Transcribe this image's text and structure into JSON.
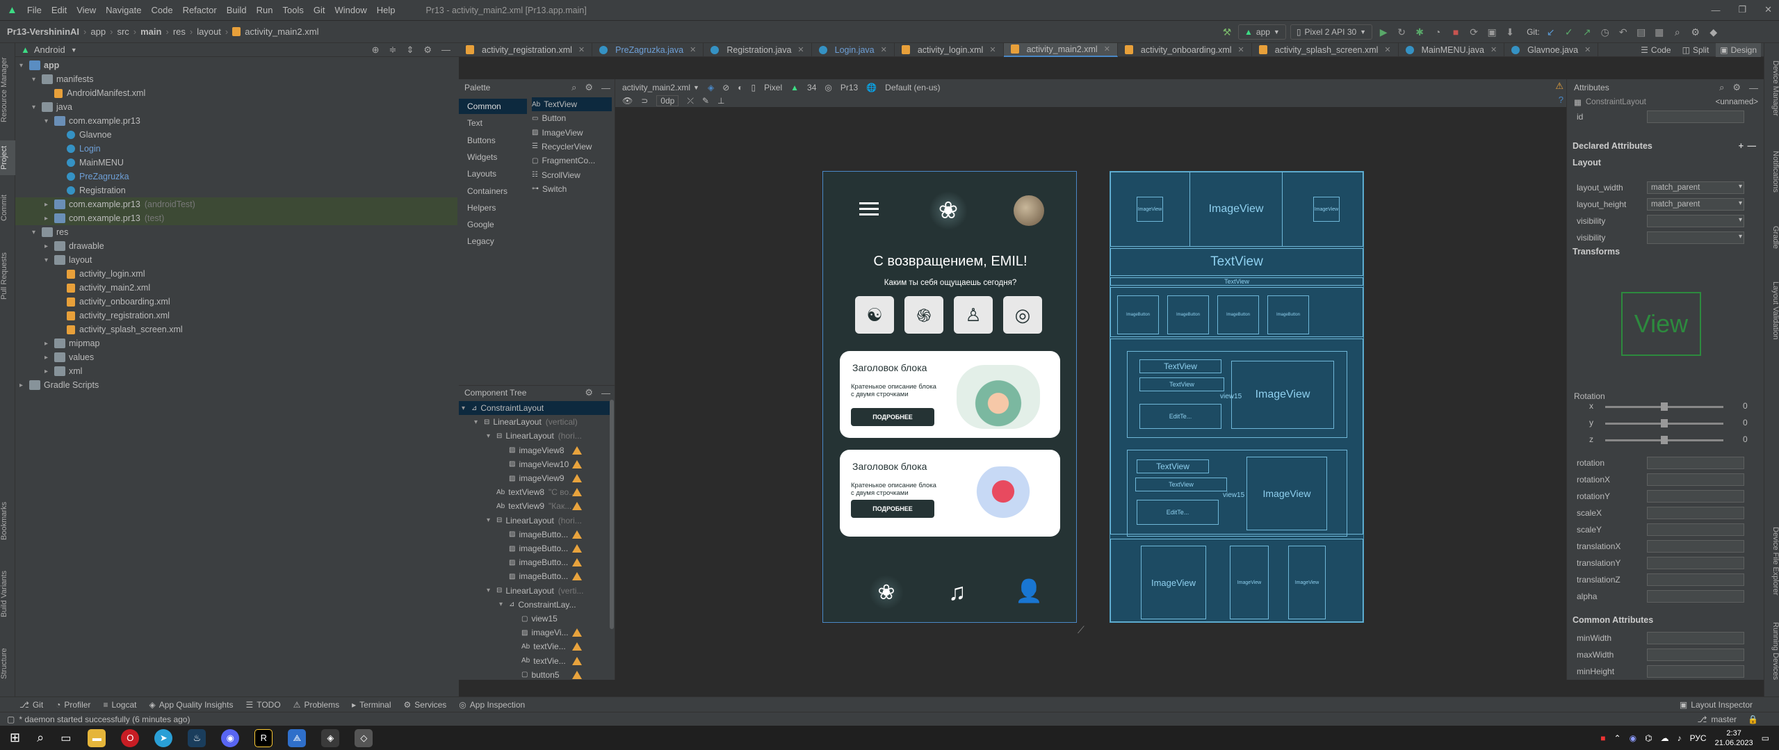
{
  "window": {
    "title": "Pr13 - activity_main2.xml [Pr13.app.main]"
  },
  "menu": [
    "File",
    "Edit",
    "View",
    "Navigate",
    "Code",
    "Refactor",
    "Build",
    "Run",
    "Tools",
    "Git",
    "Window",
    "Help"
  ],
  "breadcrumb": [
    "Pr13-VershininAI",
    "app",
    "src",
    "main",
    "res",
    "layout",
    "activity_main2.xml"
  ],
  "toolbar": {
    "run_config": "app",
    "device": "Pixel 2 API 30",
    "git_label": "Git:"
  },
  "project": {
    "view_mode": "Android"
  },
  "tree": [
    {
      "label": "app",
      "depth": 0,
      "type": "folder",
      "open": true,
      "bold": true
    },
    {
      "label": "manifests",
      "depth": 1,
      "type": "folder",
      "open": true
    },
    {
      "label": "AndroidManifest.xml",
      "depth": 2,
      "type": "xml"
    },
    {
      "label": "java",
      "depth": 1,
      "type": "folder",
      "open": true
    },
    {
      "label": "com.example.pr13",
      "depth": 2,
      "type": "pkg",
      "open": true
    },
    {
      "label": "Glavnoe",
      "depth": 3,
      "type": "java"
    },
    {
      "label": "Login",
      "depth": 3,
      "type": "java",
      "color": "#6e9fd6"
    },
    {
      "label": "MainMENU",
      "depth": 3,
      "type": "java"
    },
    {
      "label": "PreZagruzka",
      "depth": 3,
      "type": "java",
      "color": "#6e9fd6"
    },
    {
      "label": "Registration",
      "depth": 3,
      "type": "java"
    },
    {
      "label": "com.example.pr13",
      "depth": 2,
      "type": "pkg",
      "note": "(androidTest)",
      "highlight": true
    },
    {
      "label": "com.example.pr13",
      "depth": 2,
      "type": "pkg",
      "note": "(test)",
      "highlight": true
    },
    {
      "label": "res",
      "depth": 1,
      "type": "folder",
      "open": true
    },
    {
      "label": "drawable",
      "depth": 2,
      "type": "folder"
    },
    {
      "label": "layout",
      "depth": 2,
      "type": "folder",
      "open": true
    },
    {
      "label": "activity_login.xml",
      "depth": 3,
      "type": "xml"
    },
    {
      "label": "activity_main2.xml",
      "depth": 3,
      "type": "xml"
    },
    {
      "label": "activity_onboarding.xml",
      "depth": 3,
      "type": "xml"
    },
    {
      "label": "activity_registration.xml",
      "depth": 3,
      "type": "xml"
    },
    {
      "label": "activity_splash_screen.xml",
      "depth": 3,
      "type": "xml"
    },
    {
      "label": "mipmap",
      "depth": 2,
      "type": "folder"
    },
    {
      "label": "values",
      "depth": 2,
      "type": "folder"
    },
    {
      "label": "xml",
      "depth": 2,
      "type": "folder"
    },
    {
      "label": "Gradle Scripts",
      "depth": 0,
      "type": "gradle"
    }
  ],
  "editor_tabs": [
    {
      "label": "activity_registration.xml",
      "type": "xml"
    },
    {
      "label": "PreZagruzka.java",
      "type": "java",
      "color": "#6e9fd6"
    },
    {
      "label": "Registration.java",
      "type": "java"
    },
    {
      "label": "Login.java",
      "type": "java",
      "color": "#6e9fd6"
    },
    {
      "label": "activity_login.xml",
      "type": "xml"
    },
    {
      "label": "activity_main2.xml",
      "type": "xml",
      "active": true
    },
    {
      "label": "activity_onboarding.xml",
      "type": "xml"
    },
    {
      "label": "activity_splash_screen.xml",
      "type": "xml"
    },
    {
      "label": "MainMENU.java",
      "type": "java"
    },
    {
      "label": "Glavnoe.java",
      "type": "java"
    }
  ],
  "view_modes": [
    "Code",
    "Split",
    "Design"
  ],
  "palette": {
    "title": "Palette",
    "categories": [
      "Common",
      "Text",
      "Buttons",
      "Widgets",
      "Layouts",
      "Containers",
      "Helpers",
      "Google",
      "Legacy"
    ],
    "items": [
      "TextView",
      "Button",
      "ImageView",
      "RecyclerView",
      "FragmentCo...",
      "ScrollView",
      "Switch"
    ]
  },
  "design_toolbar": {
    "file": "activity_main2.xml",
    "device": "Pixel",
    "api": "34",
    "theme": "Pr13",
    "locale": "Default (en-us)",
    "dp": "0dp"
  },
  "component_tree": {
    "title": "Component Tree",
    "items": [
      {
        "label": "ConstraintLayout",
        "depth": 0,
        "sel": true
      },
      {
        "label": "LinearLayout",
        "note": "(vertical)",
        "depth": 1
      },
      {
        "label": "LinearLayout",
        "note": "(hori...",
        "depth": 2
      },
      {
        "label": "imageView8",
        "depth": 3,
        "warn": true
      },
      {
        "label": "imageView10",
        "depth": 3,
        "warn": true
      },
      {
        "label": "imageView9",
        "depth": 3,
        "warn": true
      },
      {
        "label": "textView8",
        "note": "\"С во...",
        "depth": 2,
        "warn": true
      },
      {
        "label": "textView9",
        "note": "\"Как...",
        "depth": 2,
        "warn": true
      },
      {
        "label": "LinearLayout",
        "note": "(hori...",
        "depth": 2
      },
      {
        "label": "imageButto...",
        "depth": 3,
        "warn": true
      },
      {
        "label": "imageButto...",
        "depth": 3,
        "warn": true
      },
      {
        "label": "imageButto...",
        "depth": 3,
        "warn": true
      },
      {
        "label": "imageButto...",
        "depth": 3,
        "warn": true
      },
      {
        "label": "LinearLayout",
        "note": "(verti...",
        "depth": 2
      },
      {
        "label": "ConstraintLay...",
        "depth": 3
      },
      {
        "label": "view15",
        "depth": 4
      },
      {
        "label": "imageVi...",
        "depth": 4,
        "warn": true
      },
      {
        "label": "textVie...",
        "depth": 4,
        "warn": true
      },
      {
        "label": "textVie...",
        "depth": 4,
        "warn": true
      },
      {
        "label": "button5",
        "depth": 4,
        "warn": true
      }
    ]
  },
  "phone": {
    "greeting": "С возвращением, EMIL!",
    "subtitle": "Каким ты себя ощущаешь сегодня?",
    "cards": [
      {
        "title": "Заголовок блока",
        "desc": "Кратенькое описание блока с двумя строчками",
        "button": "ПОДРОБНЕЕ"
      },
      {
        "title": "Заголовок блока",
        "desc": "Кратенькое описание блока с двумя строчками",
        "button": "ПОДРОБНЕЕ"
      }
    ]
  },
  "blueprint": {
    "image": "ImageView",
    "text": "TextView",
    "button": "ImageButton",
    "view": "view15",
    "edit": "EditTe..."
  },
  "attributes": {
    "title": "Attributes",
    "component": "ConstraintLayout",
    "unnamed": "<unnamed>",
    "rows": [
      {
        "k": "id",
        "v": ""
      },
      {
        "k": "layout_width",
        "v": "match_parent"
      },
      {
        "k": "layout_height",
        "v": "match_parent"
      },
      {
        "k": "visibility",
        "v": ""
      },
      {
        "k": "visibility",
        "v": ""
      }
    ],
    "sections": [
      "Declared Attributes",
      "Layout",
      "Transforms",
      "Common Attributes"
    ],
    "rotation_label": "Rotation",
    "rotation_axes": [
      {
        "k": "x",
        "v": "0"
      },
      {
        "k": "y",
        "v": "0"
      },
      {
        "k": "z",
        "v": "0"
      }
    ],
    "transform_props": [
      "rotation",
      "rotationX",
      "rotationY",
      "scaleX",
      "scaleY",
      "translationX",
      "translationY",
      "translationZ",
      "alpha"
    ],
    "common_props": [
      "minWidth",
      "maxWidth",
      "minHeight"
    ],
    "preview_label": "View"
  },
  "left_tabs": [
    "Resource Manager",
    "Project",
    "Commit",
    "Pull Requests",
    "Bookmarks",
    "Build Variants",
    "Structure"
  ],
  "right_tabs": [
    "Device Manager",
    "Notifications",
    "Gradle",
    "Layout Validation",
    "Device File Explorer",
    "Running Devices"
  ],
  "bottom_tools": [
    "Git",
    "Profiler",
    "Logcat",
    "App Quality Insights",
    "TODO",
    "Problems",
    "Terminal",
    "Services",
    "App Inspection"
  ],
  "layout_inspector": "Layout Inspector",
  "status": {
    "message": "* daemon started successfully (6 minutes ago)",
    "branch": "master"
  },
  "taskbar": {
    "time": "2:37",
    "date": "21.06.2023",
    "lang": "РУС"
  }
}
